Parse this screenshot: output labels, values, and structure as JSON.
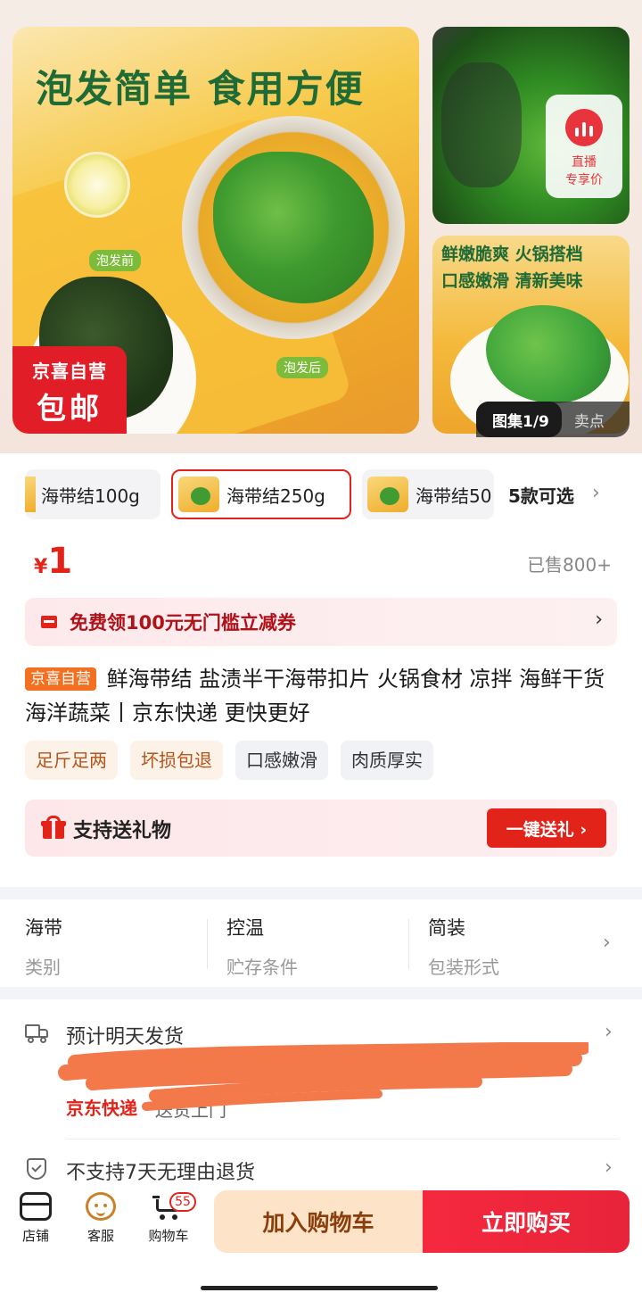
{
  "hero": {
    "main_headline": "泡发简单 食用方便",
    "tag_before": "泡发前",
    "tag_after": "泡发后",
    "badge_line1": "京喜自营",
    "badge_line2": "包邮",
    "live_label_1": "直播",
    "live_label_2": "专享价",
    "side_slogan_1": "鲜嫩脆爽 火锅搭档",
    "side_slogan_2": "口感嫩滑 清新美味",
    "gallery_counter": "图集1/9",
    "selling_points": "卖点"
  },
  "variants": {
    "items": [
      {
        "label": "海带结100g"
      },
      {
        "label": "海带结250g",
        "selected": true
      },
      {
        "label": "海带结50"
      }
    ],
    "more": "5款可选",
    "arrow": "›"
  },
  "price": {
    "currency": "¥",
    "value": "1"
  },
  "sold": "已售800+",
  "coupon": {
    "text": "免费领100元无门槛立减券",
    "arrow": "›"
  },
  "product": {
    "badge": "京喜自营",
    "title": "鲜海带结 盐渍半干海带扣片 火锅食材 凉拌 海鲜干货 海洋蔬菜丨京东快递 更快更好",
    "tags": [
      "足斤足两",
      "坏损包退",
      "口感嫩滑",
      "肉质厚实"
    ]
  },
  "gift": {
    "label": "支持送礼物",
    "button": "一键送礼 ›"
  },
  "attributes": [
    {
      "value": "海带",
      "key": "类别"
    },
    {
      "value": "控温",
      "key": "贮存条件"
    },
    {
      "value": "简装",
      "key": "包装形式"
    }
  ],
  "attributes_arrow": "›",
  "delivery": {
    "title": "预计明天发货",
    "carrier": "京东快递",
    "carrier_rest": "送货上门",
    "arrow": "›"
  },
  "returns": {
    "text": "不支持7天无理由退货",
    "arrow": "›"
  },
  "bottom_bar": {
    "store": "店铺",
    "service": "客服",
    "cart": "购物车",
    "cart_count": "55",
    "add_to_cart": "加入购物车",
    "buy_now": "立即购买"
  },
  "colors": {
    "accent": "#e2231a",
    "badge_orange": "#f37021",
    "scribble": "#f4794a"
  }
}
